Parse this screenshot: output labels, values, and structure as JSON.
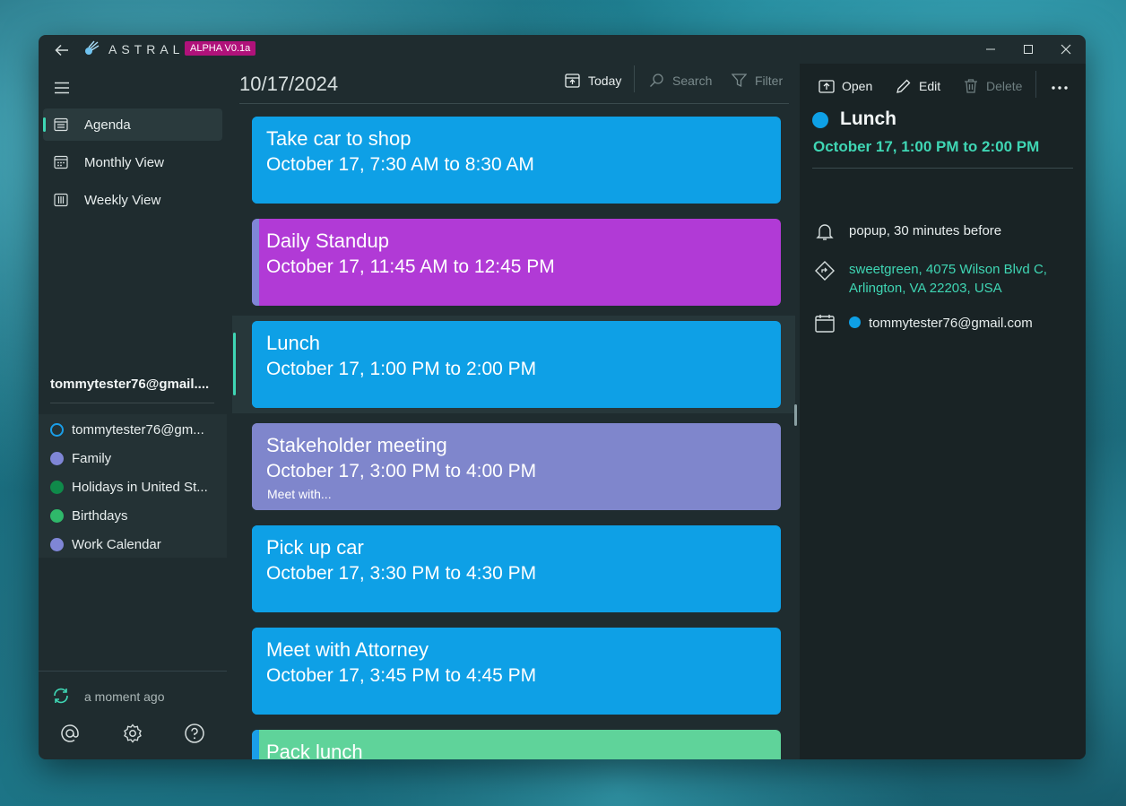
{
  "app": {
    "title": "ASTRAL",
    "badge": "ALPHA V0.1a"
  },
  "sidebar": {
    "nav": [
      {
        "label": "Agenda",
        "active": true,
        "icon": "agenda-icon"
      },
      {
        "label": "Monthly View",
        "active": false,
        "icon": "calendar-month-icon"
      },
      {
        "label": "Weekly View",
        "active": false,
        "icon": "calendar-week-icon"
      }
    ],
    "account": "tommytester76@gmail....",
    "calendars": [
      {
        "label": "tommytester76@gm...",
        "color": "#1a9ee8",
        "hollow": true
      },
      {
        "label": "Family",
        "color": "#7f86d6",
        "hollow": false
      },
      {
        "label": "Holidays in United St...",
        "color": "#0f8a4a",
        "hollow": false
      },
      {
        "label": "Birthdays",
        "color": "#2fb86a",
        "hollow": false
      },
      {
        "label": "Work Calendar",
        "color": "#7f86d6",
        "hollow": false
      }
    ],
    "sync_status": "a moment ago"
  },
  "agenda": {
    "date": "10/17/2024",
    "toolbar": {
      "today": "Today",
      "search": "Search",
      "filter": "Filter"
    },
    "events": [
      {
        "title": "Take car to shop",
        "time": "October 17, 7:30 AM to 8:30 AM",
        "note": "",
        "color": "#0ea0e6",
        "stripe": "#0ea0e6"
      },
      {
        "title": "Daily Standup",
        "time": "October 17, 11:45 AM to 12:45 PM",
        "note": "",
        "color": "#b13ad6",
        "stripe": "#7f86d6"
      },
      {
        "title": "Lunch",
        "time": "October 17, 1:00 PM to 2:00 PM",
        "note": "",
        "color": "#0ea0e6",
        "stripe": "#0ea0e6"
      },
      {
        "title": "Stakeholder meeting",
        "time": "October 17, 3:00 PM to 4:00 PM",
        "note": "Meet with...",
        "color": "#7f86cc",
        "stripe": "#7f86cc"
      },
      {
        "title": "Pick up car",
        "time": "October 17, 3:30 PM to 4:30 PM",
        "note": "",
        "color": "#0ea0e6",
        "stripe": "#0ea0e6"
      },
      {
        "title": "Meet with Attorney",
        "time": "October 17, 3:45 PM to 4:45 PM",
        "note": "",
        "color": "#0ea0e6",
        "stripe": "#0ea0e6"
      },
      {
        "title": "Pack lunch",
        "time": "",
        "note": "",
        "color": "#5fd39a",
        "stripe": "#1a9ee8"
      }
    ]
  },
  "detail": {
    "actions": {
      "open": "Open",
      "edit": "Edit",
      "delete": "Delete"
    },
    "title": "Lunch",
    "time": "October 17, 1:00 PM to 2:00 PM",
    "reminder": "popup, 30 minutes before",
    "location": "sweetgreen, 4075 Wilson Blvd C, Arlington, VA 22203, USA",
    "calendar": "tommytester76@gmail.com",
    "dot_color": "#0ea0e6"
  }
}
